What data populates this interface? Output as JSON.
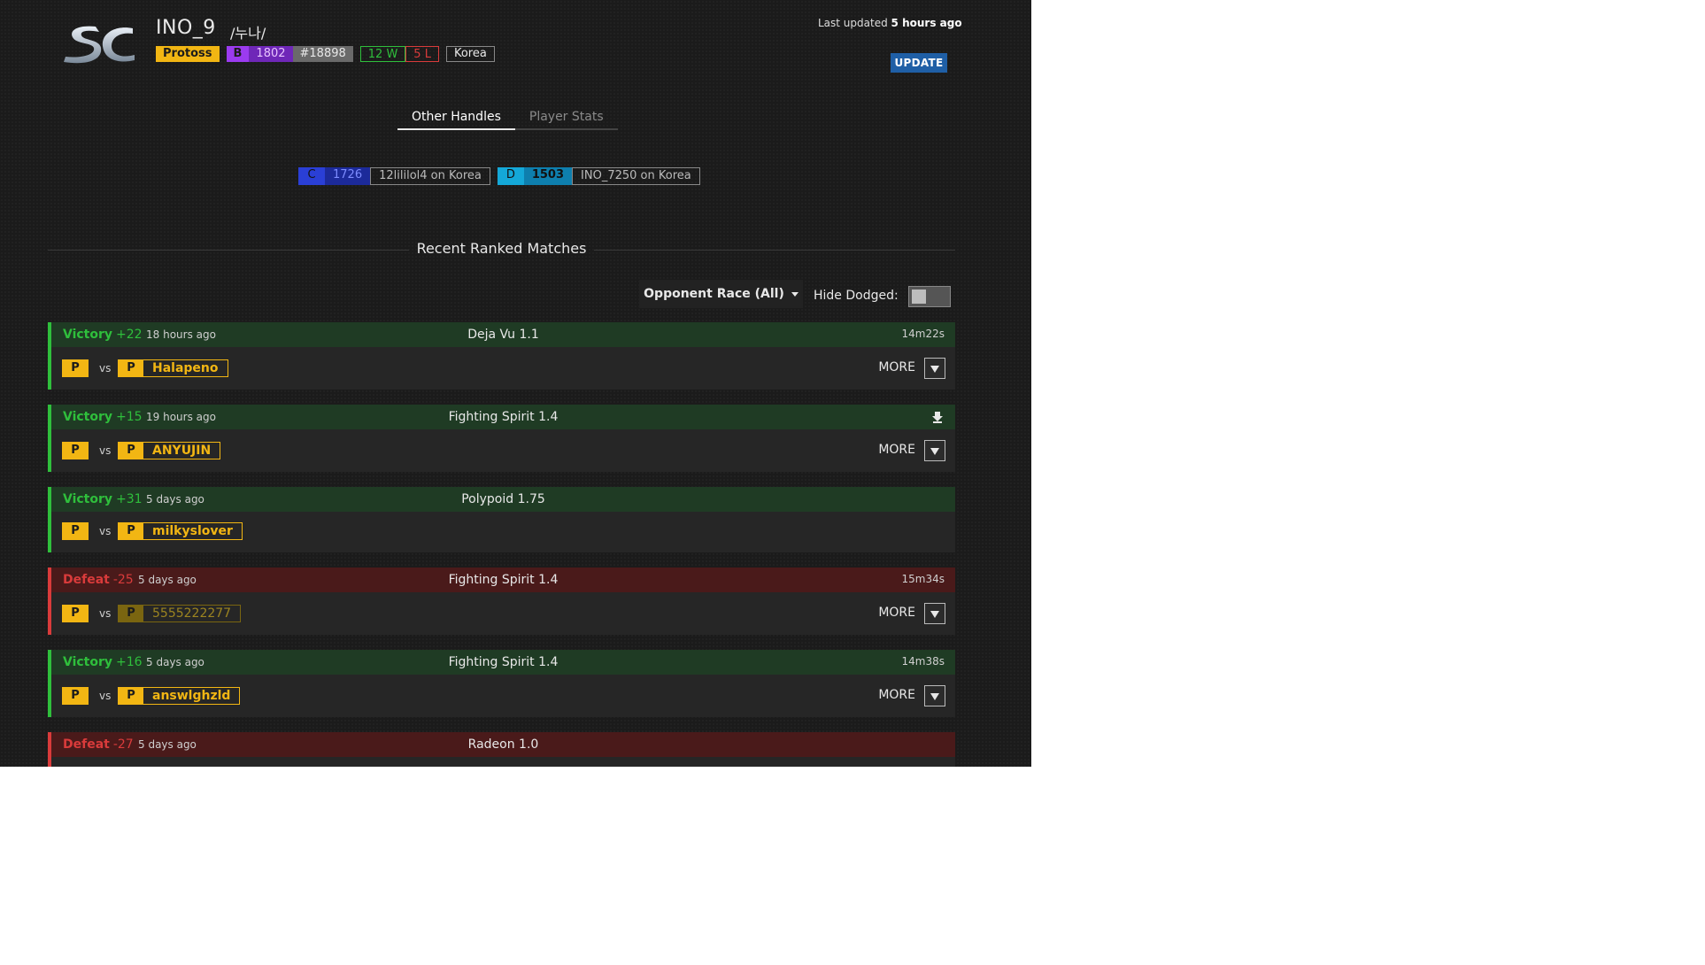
{
  "player": {
    "name": "INO_9",
    "alias": "/누나/",
    "race": "Protoss",
    "league": "B",
    "rating": "1802",
    "rank": "#18898",
    "wins": "12 W",
    "losses": "5 L",
    "region": "Korea"
  },
  "header": {
    "last_updated_prefix": "Last updated",
    "last_updated_value": "5 hours ago",
    "update_label": "UPDATE"
  },
  "tabs": [
    {
      "label": "Other Handles",
      "active": true
    },
    {
      "label": "Player Stats",
      "active": false
    }
  ],
  "handles": [
    {
      "league": "C",
      "rating": "1726",
      "name": "12lililol4 on Korea"
    },
    {
      "league": "D",
      "rating": "1503",
      "name": "INO_7250 on Korea"
    }
  ],
  "section": {
    "title": "Recent Ranked Matches"
  },
  "filters": {
    "opponent_race": "Opponent Race (All)",
    "hide_dodged_label": "Hide Dodged:",
    "hide_dodged_on": false
  },
  "matches": [
    {
      "result": "Victory",
      "delta": "+22",
      "ago": "18 hours ago",
      "map": "Deja Vu 1.1",
      "duration": "14m22s",
      "player_race": "P",
      "vs": "vs",
      "opp_race": "P",
      "opponent": "Halapeno",
      "more": "MORE"
    },
    {
      "result": "Victory",
      "delta": "+15",
      "ago": "19 hours ago",
      "map": "Fighting Spirit 1.4",
      "duration": "",
      "player_race": "P",
      "vs": "vs",
      "opp_race": "P",
      "opponent": "ANYUJIN",
      "more": "MORE"
    },
    {
      "result": "Victory",
      "delta": "+31",
      "ago": "5 days ago",
      "map": "Polypoid 1.75",
      "duration": "",
      "player_race": "P",
      "vs": "vs",
      "opp_race": "P",
      "opponent": "milkyslover",
      "more": ""
    },
    {
      "result": "Defeat",
      "delta": "-25",
      "ago": "5 days ago",
      "map": "Fighting Spirit 1.4",
      "duration": "15m34s",
      "player_race": "P",
      "vs": "vs",
      "opp_race": "P",
      "opponent": "5555222277",
      "more": "MORE"
    },
    {
      "result": "Victory",
      "delta": "+16",
      "ago": "5 days ago",
      "map": "Fighting Spirit 1.4",
      "duration": "14m38s",
      "player_race": "P",
      "vs": "vs",
      "opp_race": "P",
      "opponent": "answlghzld",
      "more": "MORE"
    },
    {
      "result": "Defeat",
      "delta": "-27",
      "ago": "5 days ago",
      "map": "Radeon 1.0",
      "duration": "",
      "player_race": "",
      "vs": "",
      "opp_race": "",
      "opponent": "",
      "more": ""
    }
  ]
}
